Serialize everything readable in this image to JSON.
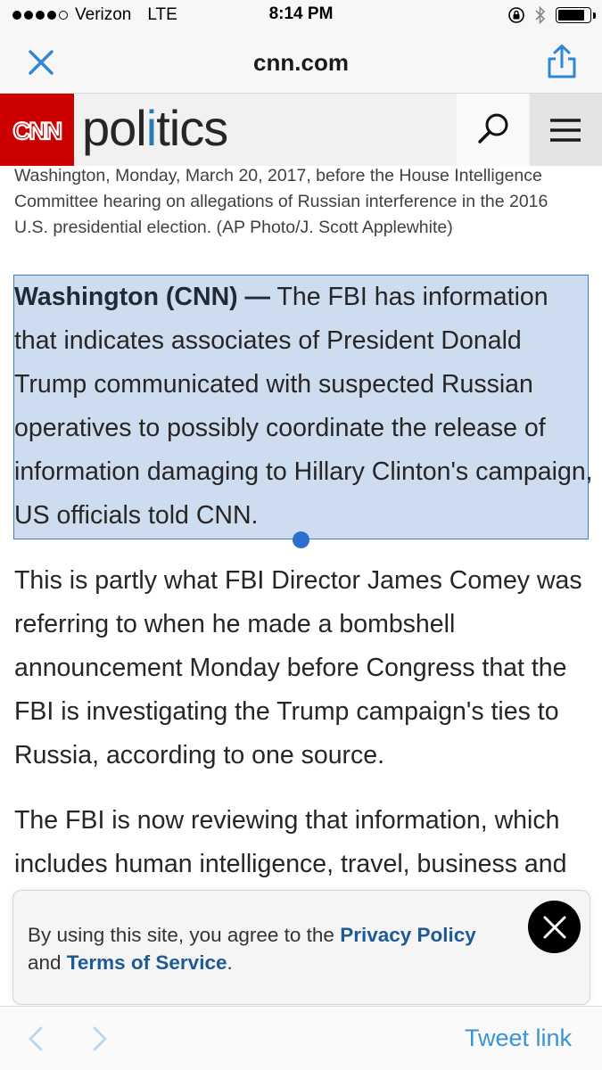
{
  "status_bar": {
    "carrier": "Verizon",
    "network": "LTE",
    "time": "8:14 PM",
    "battery_level": 0.85
  },
  "browser": {
    "url": "cnn.com",
    "close_icon": "close-icon",
    "share_icon": "share-icon"
  },
  "header": {
    "logo_text": "CNN",
    "section_pre": "pol",
    "section_accent": "i",
    "section_post": "tics",
    "brand_color": "#cc0000",
    "accent_color": "#2a7ab8"
  },
  "article": {
    "caption": "Washington, Monday, March 20, 2017, before the House Intelligence Committee hearing on allegations of Russian interference in the 2016 U.S. presidential election. (AP Photo/J. Scott Applewhite)",
    "dateline": "Washington (CNN) —",
    "p1": " The FBI has information that indicates associates of President Donald Trump communicated with suspected Russian operatives to possibly coordinate the release of information damaging to Hillary Clinton's campaign, US officials told CNN.",
    "p2": "This is partly what FBI Director James Comey was referring to when he made a bombshell announcement Monday before Congress that the FBI is investigating the Trump campaign's ties to Russia, according to one source.",
    "p3": "The FBI is now reviewing that information, which includes human intelligence, travel, business and"
  },
  "cookie": {
    "text_before": "By using this site, you agree to the ",
    "privacy_link": "Privacy Policy",
    "text_and": " and ",
    "terms_link": "Terms of Service",
    "text_end": "."
  },
  "toolbar": {
    "tweet_link": "Tweet link"
  }
}
